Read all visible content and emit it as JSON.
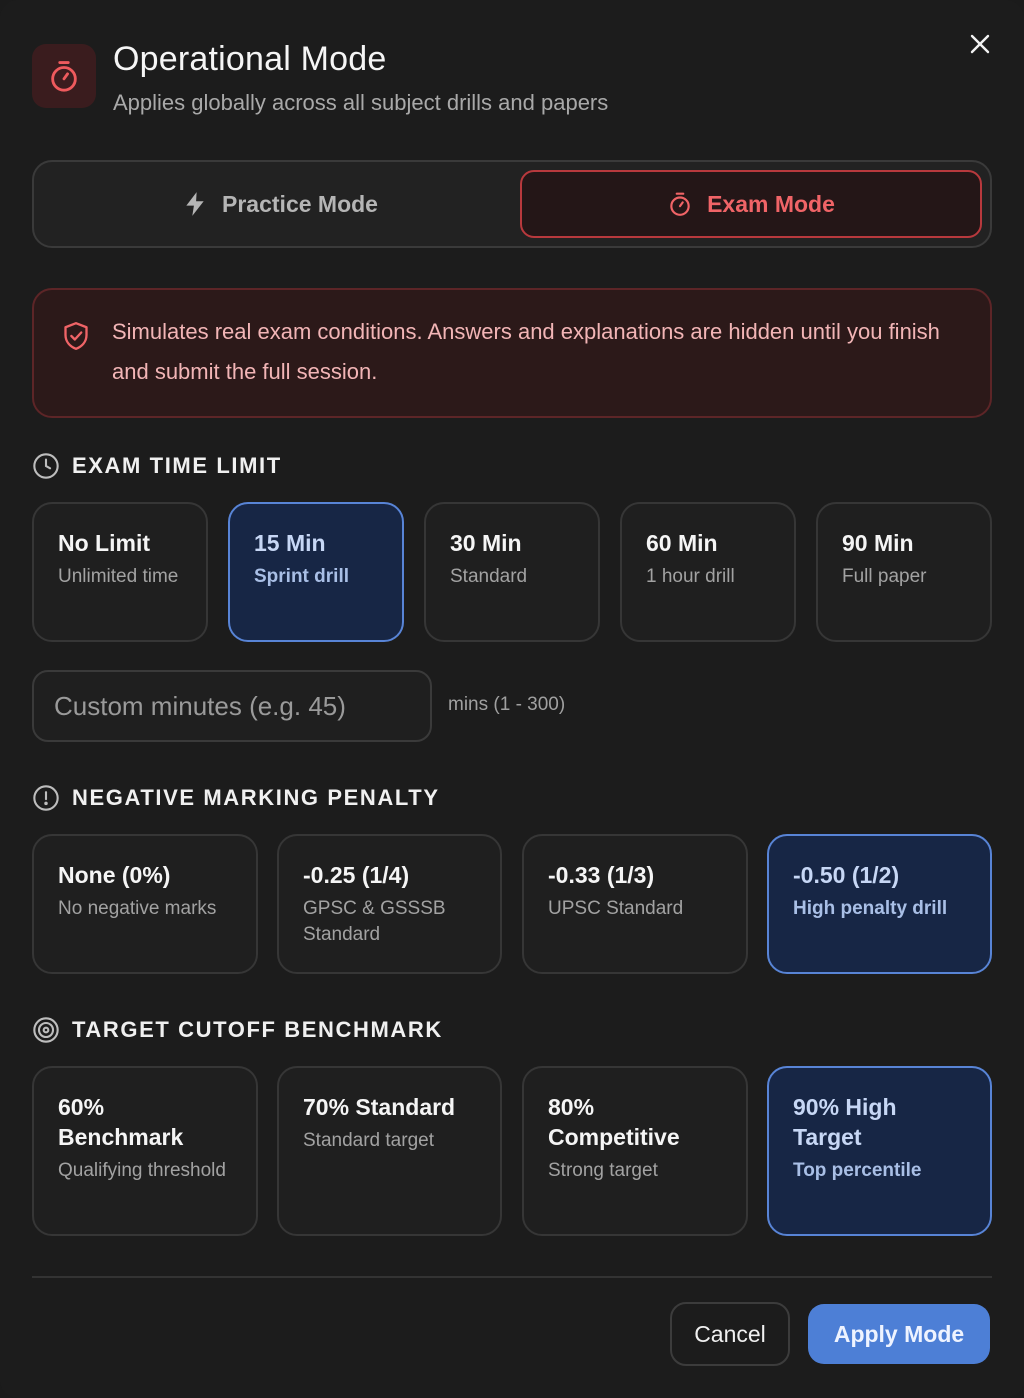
{
  "header": {
    "title": "Operational Mode",
    "subtitle": "Applies globally across all subject drills and papers"
  },
  "modes": [
    {
      "label": "Practice Mode",
      "icon": "bolt-icon",
      "selected": false
    },
    {
      "label": "Exam Mode",
      "icon": "stopwatch-icon",
      "selected": true
    }
  ],
  "notice": {
    "text": "Simulates real exam conditions. Answers and explanations are hidden until you finish and submit the full session."
  },
  "time_limit": {
    "heading": "EXAM TIME LIMIT",
    "options": [
      {
        "title": "No Limit",
        "sub": "Unlimited time",
        "selected": false
      },
      {
        "title": "15 Min",
        "sub": "Sprint drill",
        "selected": true
      },
      {
        "title": "30 Min",
        "sub": "Standard",
        "selected": false
      },
      {
        "title": "60 Min",
        "sub": "1 hour drill",
        "selected": false
      },
      {
        "title": "90 Min",
        "sub": "Full paper",
        "selected": false
      }
    ],
    "custom_placeholder": "Custom minutes (e.g. 45)",
    "custom_value": "",
    "range_note": "mins (1 - 300)"
  },
  "penalty": {
    "heading": "NEGATIVE MARKING PENALTY",
    "options": [
      {
        "title": "None (0%)",
        "sub": "No negative marks",
        "selected": false
      },
      {
        "title": "-0.25 (1/4)",
        "sub": "GPSC & GSSSB Standard",
        "selected": false
      },
      {
        "title": "-0.33 (1/3)",
        "sub": "UPSC Standard",
        "selected": false
      },
      {
        "title": "-0.50 (1/2)",
        "sub": "High penalty drill",
        "selected": true
      }
    ]
  },
  "cutoff": {
    "heading": "TARGET CUTOFF BENCHMARK",
    "options": [
      {
        "title": "60% Benchmark",
        "sub": "Qualifying threshold",
        "selected": false
      },
      {
        "title": "70% Standard",
        "sub": "Standard target",
        "selected": false
      },
      {
        "title": "80% Competitive",
        "sub": "Strong target",
        "selected": false
      },
      {
        "title": "90% High Target",
        "sub": "Top percentile",
        "selected": true
      }
    ]
  },
  "footer": {
    "cancel_label": "Cancel",
    "apply_label": "Apply Mode"
  },
  "colors": {
    "accent_red": "#f06467",
    "accent_blue": "#4d7fd6",
    "background": "#1c1c1c"
  }
}
